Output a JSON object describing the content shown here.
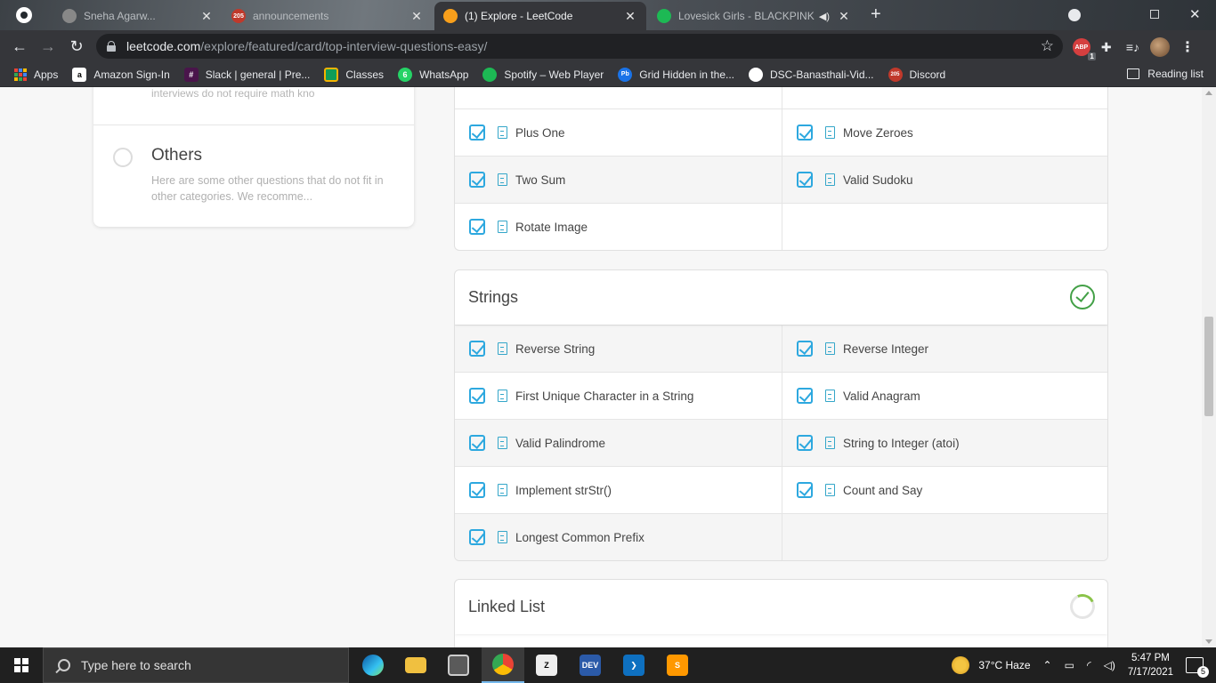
{
  "browser": {
    "tabs": [
      {
        "title": "Sneha Agarw...",
        "close": "✕",
        "active": false
      },
      {
        "title": "announcements",
        "close": "✕",
        "active": false,
        "badge": "205"
      },
      {
        "title": "(1) Explore - LeetCode",
        "close": "✕",
        "active": true
      },
      {
        "title": "Lovesick Girls - BLACKPINK",
        "close": "✕",
        "active": false
      }
    ],
    "new_tab": "+",
    "url_host": "leetcode.com",
    "url_path": "/explore/featured/card/top-interview-questions-easy/",
    "abp_label": "ABP",
    "abp_badge": "1"
  },
  "bookmarks": {
    "items": [
      {
        "label": "Apps"
      },
      {
        "label": "Amazon Sign-In",
        "icon": "a"
      },
      {
        "label": "Slack | general | Pre...",
        "icon": "#"
      },
      {
        "label": "Classes",
        "icon": ""
      },
      {
        "label": "WhatsApp",
        "icon": "6"
      },
      {
        "label": "Spotify – Web Player",
        "icon": ""
      },
      {
        "label": "Grid Hidden in the...",
        "icon": "Pb"
      },
      {
        "label": "DSC-Banasthali-Vid...",
        "icon": ""
      },
      {
        "label": "Discord",
        "icon": "205"
      }
    ],
    "reading_list": "Reading list"
  },
  "sidebar": {
    "prev_desc": "interviews do not require math kno",
    "others_title": "Others",
    "others_desc": "Here are some other questions that do not fit in other categories. We recomme..."
  },
  "arrays_tail": {
    "rows": [
      [
        "Plus One",
        "Move Zeroes"
      ],
      [
        "Two Sum",
        "Valid Sudoku"
      ],
      [
        "Rotate Image",
        ""
      ]
    ]
  },
  "strings": {
    "title": "Strings",
    "status": "completed",
    "rows": [
      [
        "Reverse String",
        "Reverse Integer"
      ],
      [
        "First Unique Character in a String",
        "Valid Anagram"
      ],
      [
        "Valid Palindrome",
        "String to Integer (atoi)"
      ],
      [
        "Implement strStr()",
        "Count and Say"
      ],
      [
        "Longest Common Prefix",
        ""
      ]
    ]
  },
  "linked_list": {
    "title": "Linked List",
    "status": "in-progress"
  },
  "taskbar": {
    "search_placeholder": "Type here to search",
    "weather": "37°C  Haze",
    "time": "5:47 PM",
    "date": "7/17/2021",
    "notifications": "5"
  },
  "colors": {
    "checkbox": "#2da8df",
    "done": "#43a047",
    "progress": "#8bc34a"
  }
}
